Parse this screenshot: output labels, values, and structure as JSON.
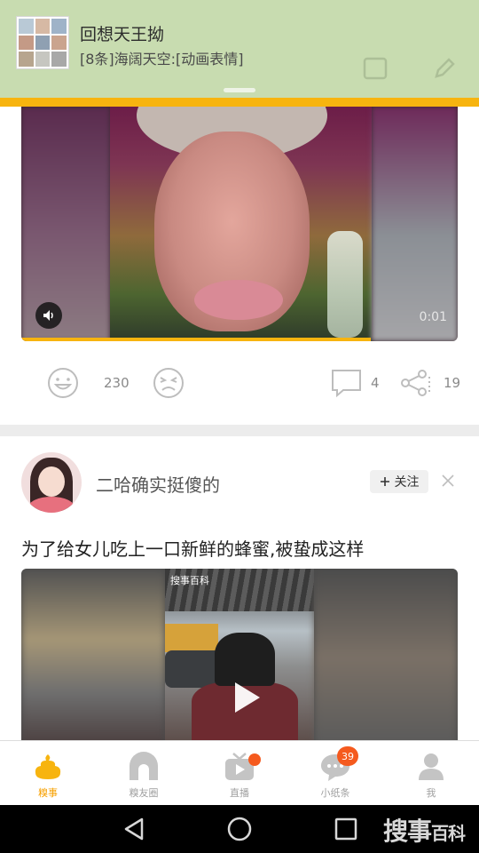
{
  "notification": {
    "title": "回想天王拗",
    "message": "[8条]海阔天空:[动画表情]"
  },
  "post1": {
    "video_time": "0:01",
    "video_progress_fraction": 0.8,
    "likes": "230",
    "comments": "4",
    "shares": "19"
  },
  "post2": {
    "username": "二哈确实挺傻的",
    "follow_label": "关注",
    "title": "为了给女儿吃上一口新鲜的蜂蜜,被蛰成这样",
    "video_logo": "搜事百科"
  },
  "tabbar": {
    "items": [
      {
        "label": "糗事",
        "icon": "poop-icon",
        "active": true
      },
      {
        "label": "糗友圈",
        "icon": "circle-icon",
        "active": false
      },
      {
        "label": "直播",
        "icon": "tv-icon",
        "active": false
      },
      {
        "label": "小纸条",
        "icon": "chat-icon",
        "active": false,
        "badge": "39"
      },
      {
        "label": "我",
        "icon": "profile-icon",
        "active": false
      }
    ]
  },
  "watermark": {
    "text": "搜事",
    "small": "百科"
  },
  "colors": {
    "accent": "#f7b40f",
    "notification_bg": "#c8dcb0",
    "badge": "#f55a1e"
  }
}
